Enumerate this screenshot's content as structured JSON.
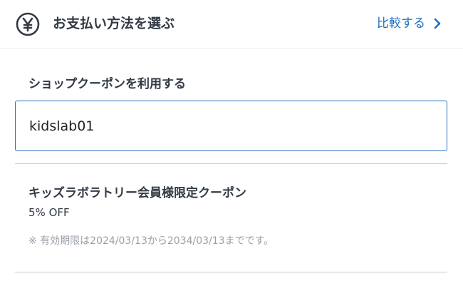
{
  "header": {
    "icon": "yen-circle-icon",
    "title": "お支払い方法を選ぶ",
    "compare_label": "比較する",
    "compare_icon": "chevron-right-icon"
  },
  "coupon_entry": {
    "label": "ショップクーポンを利用する",
    "value": "kidslab01"
  },
  "coupon": {
    "name": "キッズラボラトリー会員様限定クーポン",
    "discount": "5% OFF",
    "validity": "※ 有効期限は2024/03/13から2034/03/13までです。"
  },
  "colors": {
    "accent": "#1f6fbf",
    "text": "#333a45",
    "muted": "#9a9fa8",
    "divider": "#c9ccd1"
  }
}
